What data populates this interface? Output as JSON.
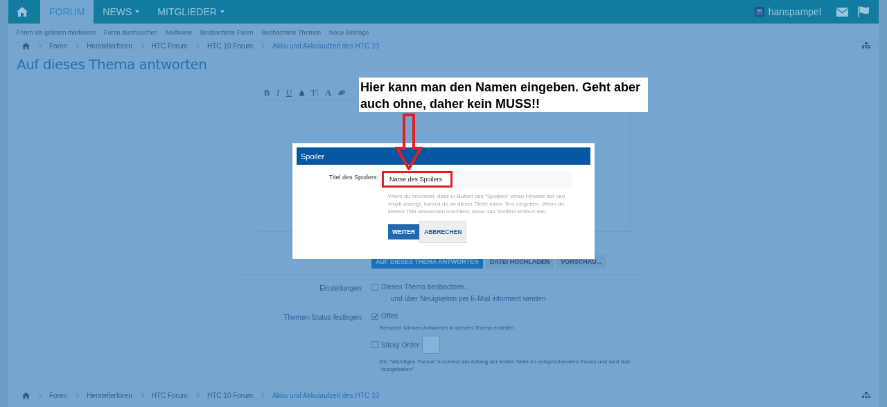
{
  "nav": {
    "tabs": [
      {
        "kind": "home",
        "selected": false
      },
      {
        "kind": "text",
        "label": "FORUM",
        "dropdown": false,
        "selected": true
      },
      {
        "kind": "text",
        "label": "NEWS",
        "dropdown": true,
        "selected": false
      },
      {
        "kind": "text",
        "label": "MITGLIEDER",
        "dropdown": true,
        "selected": false
      }
    ],
    "user": {
      "name": "hanspampel"
    }
  },
  "subnav": [
    "Foren als gelesen markieren",
    "Foren durchsuchen",
    "Multiview",
    "Beobachtete Foren",
    "Beobachtete Themen",
    "Neue Beiträge"
  ],
  "breadcrumb_top": [
    "Foren",
    "Herstellerforen",
    "HTC Forum",
    "HTC 10 Forum",
    "Akku und Akkulaufzeit des HTC 10"
  ],
  "title": "Auf dieses Thema antworten",
  "editor": {
    "toolbar": [
      {
        "kind": "bold",
        "label": "B"
      },
      {
        "kind": "italic",
        "label": "I"
      },
      {
        "kind": "underline",
        "label": "U"
      },
      {
        "kind": "drop"
      },
      {
        "kind": "plain",
        "label": "T⁞"
      },
      {
        "kind": "bold",
        "label": "A"
      },
      {
        "kind": "link"
      }
    ]
  },
  "actions": [
    {
      "label": "AUF DIESES THEMA ANTWORTEN",
      "primary": true
    },
    {
      "label": "DATEI HOCHLADEN",
      "primary": false
    },
    {
      "label": "VORSCHAU...",
      "primary": false
    }
  ],
  "settings": [
    {
      "label": "Einstellungen:",
      "options": [
        {
          "text": "Dieses Thema beobachten...",
          "checked": false,
          "disabled": false,
          "children": [
            {
              "text": "und über Neuigkeiten per E-Mail informiert werden",
              "checked": false,
              "disabled": true
            }
          ]
        }
      ]
    },
    {
      "label": "Themen-Status festlegen:",
      "options": [
        {
          "text": "Offen",
          "checked": true,
          "disabled": false,
          "hint": "Benutzer können Antworten in diesem Thema erstellen"
        },
        {
          "text": "Sticky Order",
          "checked": false,
          "disabled": false,
          "swatch": true,
          "hint": "Ein \"Wichtiges Thema\" erscheint am Anfang der ersten Seite im entsprechendem Forum und wird dort \"festgehalten\""
        }
      ]
    }
  ],
  "breadcrumb_bottom": [
    "Foren",
    "Herstellerforen",
    "HTC Forum",
    "HTC 10 Forum",
    "Akku und Akkulaufzeit des HTC 10"
  ],
  "dialog": {
    "title": "Spoiler",
    "label": "Titel des Spoilers:",
    "value": "Name des Spoilers",
    "help": "Wenn du möchtest, dass er Button des \"Spoilers\" einen Hinweis auf den Inhalt anzeigt, kannst du an dieser Stelle einen Text eingeben. Wenn du keinen Titel verwenden möchtest, lasse das Textfeld einfach leer.",
    "buttons": [
      {
        "label": "WEITER",
        "primary": true
      },
      {
        "label": "ABBRECHEN",
        "primary": false
      }
    ]
  },
  "annotation": {
    "text": "Hier kann man den Namen eingeben. Geht aber auch ohne, daher kein MUSS!!"
  }
}
